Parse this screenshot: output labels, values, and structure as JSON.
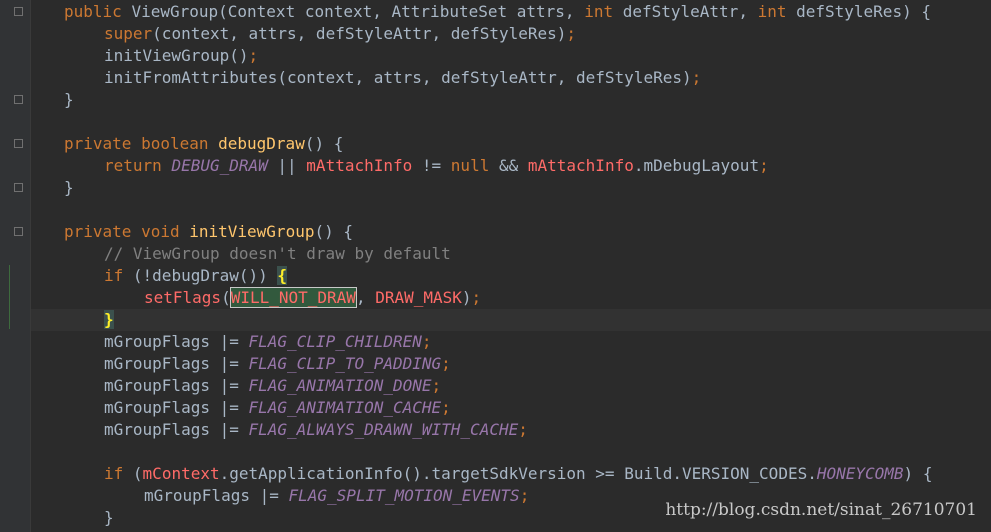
{
  "lines": [
    [
      [
        "kw",
        "public "
      ],
      [
        "d",
        "ViewGroup(Context context, AttributeSet attrs, "
      ],
      [
        "kw",
        "int "
      ],
      [
        "d",
        "defStyleAttr, "
      ],
      [
        "kw",
        "int "
      ],
      [
        "d",
        "defStyleRes) {"
      ]
    ],
    [
      [
        "kw",
        "super"
      ],
      [
        "d",
        "(context, attrs, defStyleAttr, defStyleRes)"
      ],
      [
        "kw",
        ";"
      ]
    ],
    [
      [
        "d",
        "initViewGroup()"
      ],
      [
        "kw",
        ";"
      ]
    ],
    [
      [
        "d",
        "initFromAttributes(context, attrs, defStyleAttr, defStyleRes)"
      ],
      [
        "kw",
        ";"
      ]
    ],
    [
      [
        "d",
        "}"
      ]
    ],
    [],
    [
      [
        "kw",
        "private boolean "
      ],
      [
        "fn",
        "debugDraw"
      ],
      [
        "d",
        "() {"
      ]
    ],
    [
      [
        "kw",
        "return "
      ],
      [
        "cst",
        "DEBUG_DRAW"
      ],
      [
        "d",
        " || "
      ],
      [
        "red",
        "mAttachInfo"
      ],
      [
        "d",
        " != "
      ],
      [
        "kw",
        "null "
      ],
      [
        "d",
        "&& "
      ],
      [
        "red",
        "mAttachInfo"
      ],
      [
        "d",
        ".mDebugLayout"
      ],
      [
        "kw",
        ";"
      ]
    ],
    [
      [
        "d",
        "}"
      ]
    ],
    [],
    [
      [
        "kw",
        "private void "
      ],
      [
        "fn",
        "initViewGroup"
      ],
      [
        "d",
        "() {"
      ]
    ],
    [
      [
        "cm",
        "// ViewGroup doesn't draw by default"
      ]
    ],
    [
      [
        "kw",
        "if "
      ],
      [
        "d",
        "(!debugDraw()) "
      ],
      [
        "brace",
        "{"
      ]
    ],
    [
      [
        "red",
        "setFlags"
      ],
      [
        "d",
        "("
      ],
      [
        "box",
        "WILL_NOT_DRAW"
      ],
      [
        "d",
        ", "
      ],
      [
        "red",
        "DRAW_MASK"
      ],
      [
        "d",
        ")"
      ],
      [
        "kw",
        ";"
      ]
    ],
    [
      [
        "brace",
        "}"
      ]
    ],
    [
      [
        "d",
        "mGroupFlags |= "
      ],
      [
        "cst",
        "FLAG_CLIP_CHILDREN"
      ],
      [
        "kw",
        ";"
      ]
    ],
    [
      [
        "d",
        "mGroupFlags |= "
      ],
      [
        "cst",
        "FLAG_CLIP_TO_PADDING"
      ],
      [
        "kw",
        ";"
      ]
    ],
    [
      [
        "d",
        "mGroupFlags |= "
      ],
      [
        "cst",
        "FLAG_ANIMATION_DONE"
      ],
      [
        "kw",
        ";"
      ]
    ],
    [
      [
        "d",
        "mGroupFlags |= "
      ],
      [
        "cst",
        "FLAG_ANIMATION_CACHE"
      ],
      [
        "kw",
        ";"
      ]
    ],
    [
      [
        "d",
        "mGroupFlags |= "
      ],
      [
        "cst",
        "FLAG_ALWAYS_DRAWN_WITH_CACHE"
      ],
      [
        "kw",
        ";"
      ]
    ],
    [],
    [
      [
        "kw",
        "if "
      ],
      [
        "d",
        "("
      ],
      [
        "red",
        "mContext"
      ],
      [
        "d",
        ".getApplicationInfo().targetSdkVersion >= Build.VERSION_CODES."
      ],
      [
        "cst",
        "HONEYCOMB"
      ],
      [
        "d",
        ") {"
      ]
    ],
    [
      [
        "d",
        "mGroupFlags |= "
      ],
      [
        "cst",
        "FLAG_SPLIT_MOTION_EVENTS"
      ],
      [
        "kw",
        ";"
      ]
    ],
    [
      [
        "d",
        "}"
      ]
    ]
  ],
  "watermark": "http://blog.csdn.net/sinat_26710701",
  "colors": {
    "background": "#2b2b2b",
    "keyword": "#cc7832",
    "default": "#a9b7c6",
    "method": "#ffc66d",
    "field": "#9876aa",
    "comment": "#808080",
    "error": "#ff6b68"
  }
}
